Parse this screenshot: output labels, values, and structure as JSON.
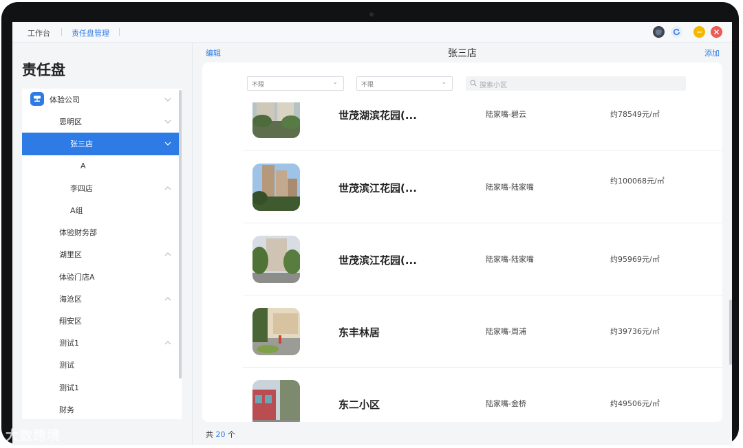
{
  "tabs": [
    {
      "label": "工作台",
      "active": false
    },
    {
      "label": "责任盘管理",
      "active": true
    }
  ],
  "sidebar": {
    "title": "责任盘",
    "items": [
      {
        "label": "体验公司",
        "level": 0,
        "chevron": "down",
        "selected": false,
        "icon": "company-icon"
      },
      {
        "label": "思明区",
        "level": 1,
        "chevron": "down",
        "selected": false
      },
      {
        "label": "张三店",
        "level": 2,
        "chevron": "down",
        "selected": true
      },
      {
        "label": "A",
        "level": 3,
        "chevron": "",
        "selected": false
      },
      {
        "label": "李四店",
        "level": 2,
        "chevron": "up",
        "selected": false
      },
      {
        "label": "A组",
        "level": 2,
        "chevron": "",
        "selected": false
      },
      {
        "label": "体验财务部",
        "level": 1,
        "chevron": "",
        "selected": false
      },
      {
        "label": "湖里区",
        "level": 1,
        "chevron": "up",
        "selected": false
      },
      {
        "label": "体验门店A",
        "level": 1,
        "chevron": "",
        "selected": false
      },
      {
        "label": "海沧区",
        "level": 1,
        "chevron": "up",
        "selected": false
      },
      {
        "label": "翔安区",
        "level": 1,
        "chevron": "",
        "selected": false
      },
      {
        "label": "测试1",
        "level": 1,
        "chevron": "up",
        "selected": false
      },
      {
        "label": "测试",
        "level": 1,
        "chevron": "",
        "selected": false
      },
      {
        "label": "测试1",
        "level": 1,
        "chevron": "",
        "selected": false
      },
      {
        "label": "财务",
        "level": 1,
        "chevron": "",
        "selected": false
      }
    ]
  },
  "main": {
    "edit_label": "编辑",
    "title": "张三店",
    "add_label": "添加",
    "filters": [
      {
        "value": "不限"
      },
      {
        "value": "不限"
      }
    ],
    "search_placeholder": "搜索小区",
    "rows": [
      {
        "name": "世茂湖滨花园(...",
        "area": "陆家嘴-碧云",
        "price": "约78549元/㎡"
      },
      {
        "name": "世茂滨江花园(...",
        "area": "陆家嘴-陆家嘴",
        "price": "约100068元/㎡"
      },
      {
        "name": "世茂滨江花园(...",
        "area": "陆家嘴-陆家嘴",
        "price": "约95969元/㎡"
      },
      {
        "name": "东丰林居",
        "area": "陆家嘴-周浦",
        "price": "约39736元/㎡"
      },
      {
        "name": "东二小区",
        "area": "陆家嘴-金桥",
        "price": "约49506元/㎡"
      }
    ],
    "total_prefix": "共",
    "total_count": "20",
    "total_suffix": "个"
  },
  "watermark": "大数跨境",
  "colors": {
    "accent": "#2f7be6",
    "minimize": "#f5b800",
    "close": "#ec5a55"
  }
}
